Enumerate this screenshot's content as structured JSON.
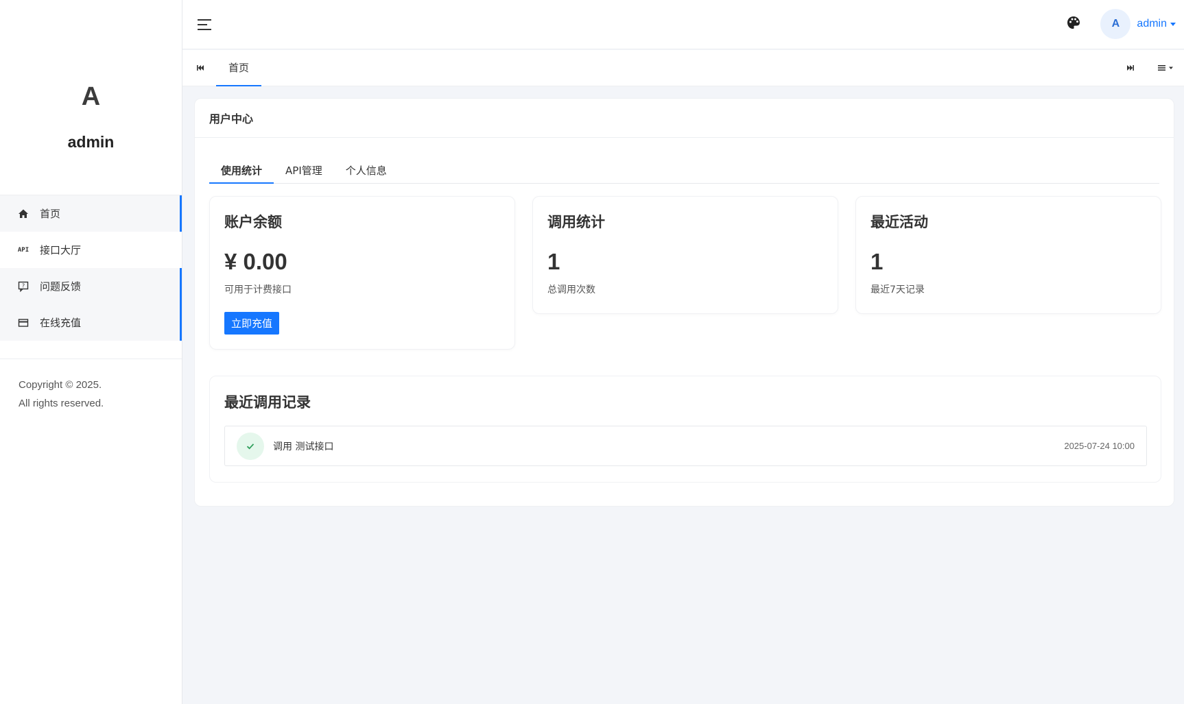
{
  "sidebar": {
    "avatar_letter": "A",
    "username": "admin",
    "items": [
      {
        "label": "首页",
        "icon": "home-icon"
      },
      {
        "label": "接口大厅",
        "icon": "api-icon",
        "icon_text": "API"
      },
      {
        "label": "问题反馈",
        "icon": "feedback-icon"
      },
      {
        "label": "在线充值",
        "icon": "credit-card-icon"
      }
    ],
    "copyright_line1": "Copyright © 2025.",
    "copyright_line2": "All rights reserved."
  },
  "header": {
    "avatar_letter": "A",
    "username": "admin"
  },
  "tabbar": {
    "tabs": [
      {
        "label": "首页"
      }
    ]
  },
  "card": {
    "title": "用户中心",
    "subtabs": [
      {
        "label": "使用统计"
      },
      {
        "label": "API管理"
      },
      {
        "label": "个人信息"
      }
    ],
    "stats": [
      {
        "title": "账户余额",
        "value": "¥ 0.00",
        "sub": "可用于计费接口",
        "button": "立即充值"
      },
      {
        "title": "调用统计",
        "value": "1",
        "sub": "总调用次数"
      },
      {
        "title": "最近活动",
        "value": "1",
        "sub": "最近7天记录"
      }
    ],
    "records": {
      "title": "最近调用记录",
      "items": [
        {
          "text": "调用 测试接口",
          "time": "2025-07-24 10:00",
          "status": "success"
        }
      ]
    }
  },
  "colors": {
    "accent": "#1677ff",
    "background": "#f3f5f9",
    "success_bg": "#e5f7ec",
    "success": "#2f9e5b"
  }
}
